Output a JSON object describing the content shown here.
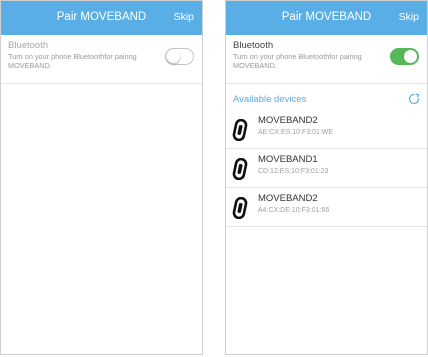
{
  "colors": {
    "header": "#5aaee6",
    "toggle_on": "#55b85a",
    "accent": "#5aaee6"
  },
  "screen_left": {
    "header": {
      "title": "Pair MOVEBAND",
      "skip_label": "Skip"
    },
    "bluetooth": {
      "title": "Bluetooth",
      "description": "Turn on your phone Bluetoothfor pairing MOVEBAND.",
      "toggle_on": false
    }
  },
  "screen_right": {
    "header": {
      "title": "Pair MOVEBAND",
      "skip_label": "Skip"
    },
    "bluetooth": {
      "title": "Bluetooth",
      "description": "Turn on your phone Bluetoothfor pairing MOVEBAND.",
      "toggle_on": true
    },
    "available_devices_label": "Available devices",
    "refresh_icon": "refresh-icon",
    "devices": [
      {
        "name": "MOVEBAND2",
        "mac": "AE:CX:ES:10:F3:01:WE",
        "icon": "band-icon"
      },
      {
        "name": "MOVEBAND1",
        "mac": "CD:12:ES:10:F3:01:23",
        "icon": "band-icon"
      },
      {
        "name": "MOVEBAND2",
        "mac": "A4:CX:DE:10:F3:01:66",
        "icon": "band-icon"
      }
    ]
  }
}
